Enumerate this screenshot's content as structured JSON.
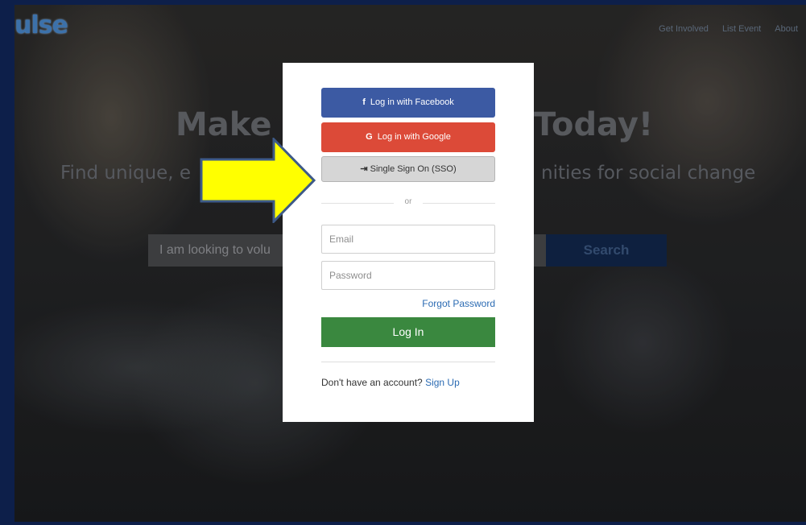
{
  "site": {
    "logo_text": "ulse",
    "nav": [
      "Get Involved",
      "List Event",
      "About"
    ]
  },
  "hero": {
    "headline_left": "Make",
    "headline_right": "Today!",
    "subheadline_left": "Find unique, e",
    "subheadline_right": "nities for social change",
    "search_placeholder": "I am looking to volu",
    "search_button": "Search"
  },
  "modal": {
    "facebook_label": "Log in with Facebook",
    "facebook_icon": "f",
    "google_label": "Log in with Google",
    "google_icon": "G",
    "sso_label": "Single Sign On (SSO)",
    "sso_icon": "⇥",
    "divider_text": "or",
    "email_placeholder": "Email",
    "password_placeholder": "Password",
    "forgot_label": "Forgot Password",
    "login_label": "Log In",
    "no_account_text": "Don't have an account?",
    "signup_label": "Sign Up"
  },
  "colors": {
    "facebook": "#3c5aa3",
    "google": "#dc4a38",
    "sso": "#d6d6d6",
    "login": "#3a883f",
    "link": "#2b6bb3",
    "arrow_fill": "#ffff00",
    "arrow_stroke": "#3d5a88"
  },
  "annotation": {
    "icon": "yellow-arrow-icon"
  }
}
